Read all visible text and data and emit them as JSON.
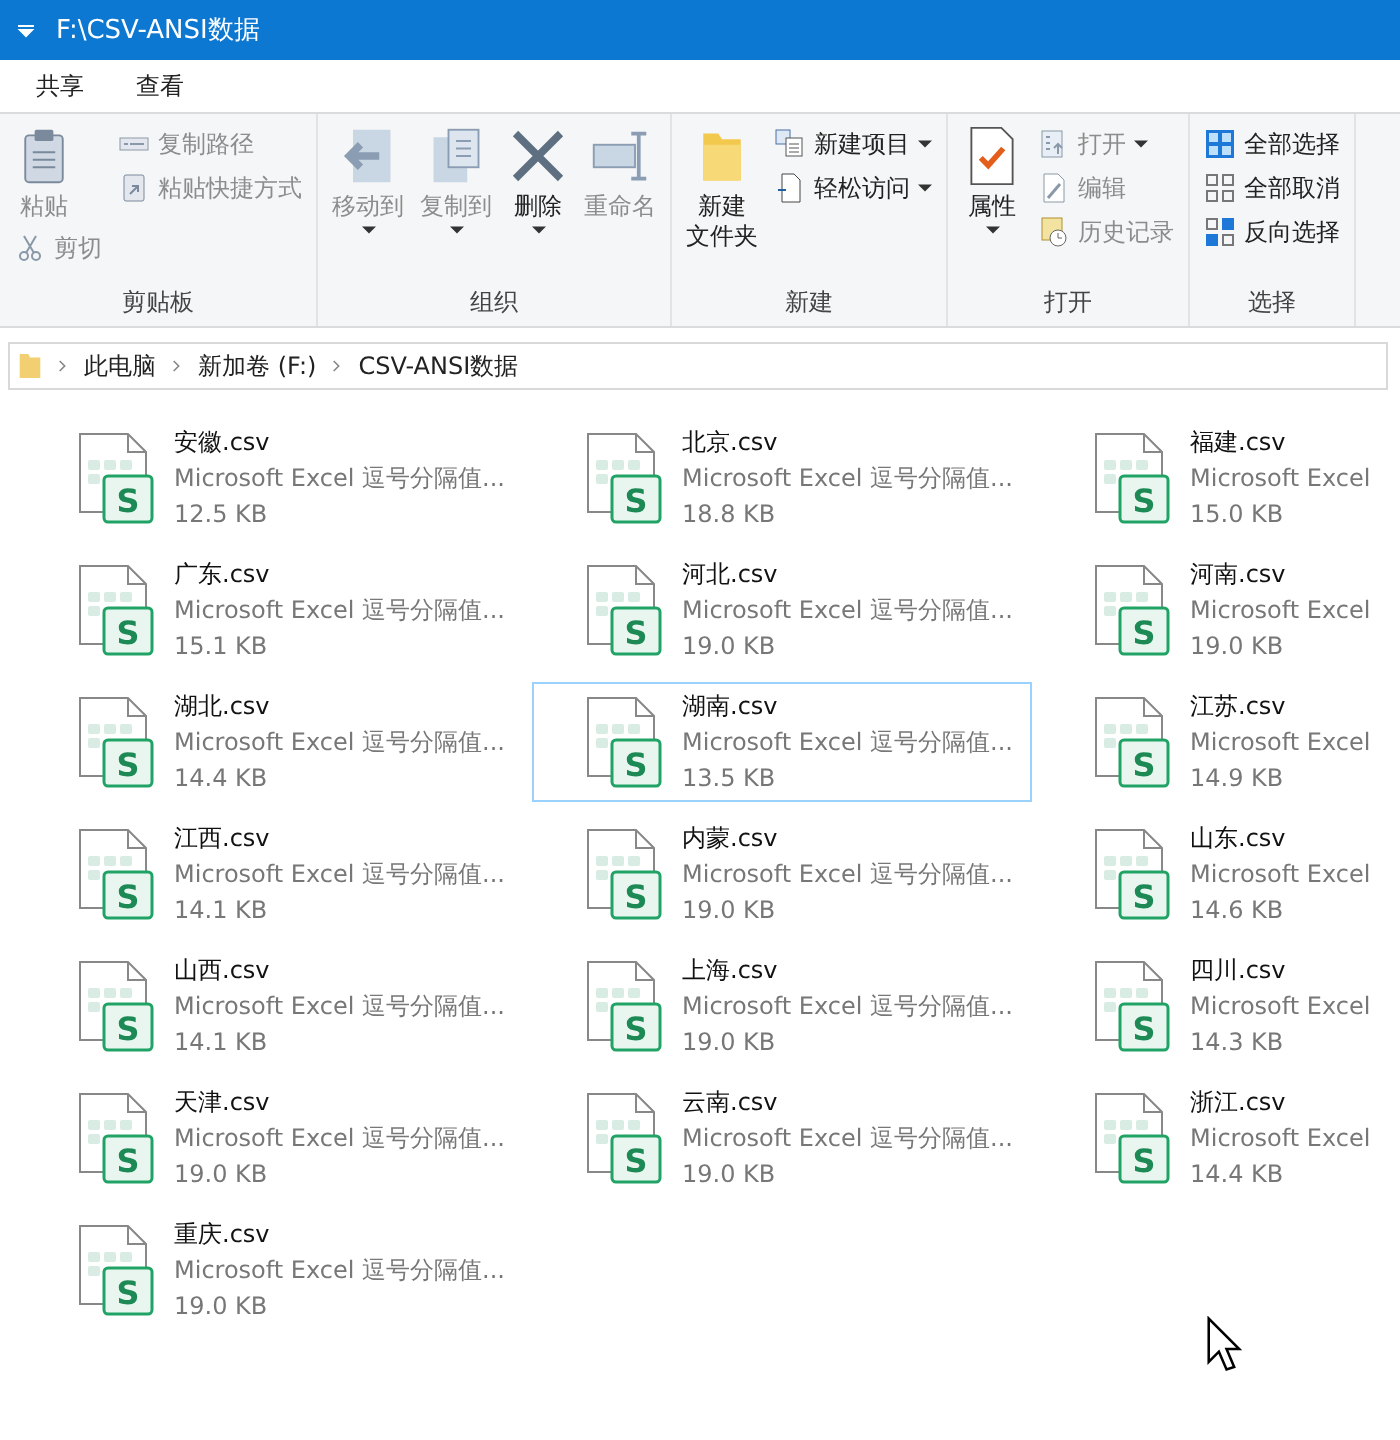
{
  "window": {
    "title": "F:\\CSV-ANSI数据"
  },
  "ribbon_tabs": [
    {
      "label": "共享",
      "selected": false
    },
    {
      "label": "查看",
      "selected": false
    }
  ],
  "ribbon": {
    "groups": [
      {
        "label": "剪贴板",
        "columns": [
          [
            {
              "kind": "large",
              "label": "粘贴",
              "disabled": true,
              "dropdown": false
            },
            {
              "kind": "small",
              "label": "剪切",
              "disabled": true,
              "dropdown": false
            }
          ],
          [
            {
              "kind": "small",
              "label": "复制路径",
              "disabled": true,
              "dropdown": false
            },
            {
              "kind": "small",
              "label": "粘贴快捷方式",
              "disabled": true,
              "dropdown": false
            }
          ]
        ]
      },
      {
        "label": "组织",
        "columns": [
          [
            {
              "kind": "large",
              "label": "移动到",
              "disabled": true,
              "dropdown": true
            }
          ],
          [
            {
              "kind": "large",
              "label": "复制到",
              "disabled": true,
              "dropdown": true
            }
          ],
          [
            {
              "kind": "large",
              "label": "删除",
              "disabled": false,
              "dropdown": true
            }
          ],
          [
            {
              "kind": "large",
              "label": "重命名",
              "disabled": true,
              "dropdown": false
            }
          ]
        ]
      },
      {
        "label": "新建",
        "columns": [
          [
            {
              "kind": "large",
              "label": "新建",
              "label_2": "文件夹",
              "disabled": false,
              "dropdown": false
            }
          ],
          [
            {
              "kind": "small",
              "label": "新建项目",
              "disabled": false,
              "dropdown": true
            },
            {
              "kind": "small",
              "label": "轻松访问",
              "disabled": false,
              "dropdown": true
            }
          ]
        ]
      },
      {
        "label": "打开",
        "columns": [
          [
            {
              "kind": "large",
              "label": "属性",
              "disabled": false,
              "dropdown": true
            }
          ],
          [
            {
              "kind": "small",
              "label": "打开",
              "disabled": true,
              "dropdown": true
            },
            {
              "kind": "small",
              "label": "编辑",
              "disabled": true,
              "dropdown": false
            },
            {
              "kind": "small",
              "label": "历史记录",
              "disabled": true,
              "dropdown": false
            }
          ]
        ]
      },
      {
        "label": "选择",
        "columns": [
          [
            {
              "kind": "small",
              "label": "全部选择",
              "disabled": false,
              "dropdown": false
            },
            {
              "kind": "small",
              "label": "全部取消",
              "disabled": false,
              "dropdown": false
            },
            {
              "kind": "small",
              "label": "反向选择",
              "disabled": false,
              "dropdown": false
            }
          ]
        ]
      }
    ]
  },
  "breadcrumb": [
    "此电脑",
    "新加卷 (F:)",
    "CSV-ANSI数据"
  ],
  "files": [
    {
      "name": "安徽.csv",
      "icon_letter": "S",
      "type": "Microsoft Excel 逗号分隔值...",
      "size": "12.5 KB",
      "selected": false
    },
    {
      "name": "北京.csv",
      "icon_letter": "S",
      "type": "Microsoft Excel 逗号分隔值...",
      "size": "18.8 KB",
      "selected": false
    },
    {
      "name": "福建.csv",
      "icon_letter": "S",
      "type": "Microsoft Excel",
      "size": "15.0 KB",
      "selected": false
    },
    {
      "name": "广东.csv",
      "icon_letter": "S",
      "type": "Microsoft Excel 逗号分隔值...",
      "size": "15.1 KB",
      "selected": false
    },
    {
      "name": "河北.csv",
      "icon_letter": "S",
      "type": "Microsoft Excel 逗号分隔值...",
      "size": "19.0 KB",
      "selected": false
    },
    {
      "name": "河南.csv",
      "icon_letter": "S",
      "type": "Microsoft Excel",
      "size": "19.0 KB",
      "selected": false
    },
    {
      "name": "湖北.csv",
      "icon_letter": "S",
      "type": "Microsoft Excel 逗号分隔值...",
      "size": "14.4 KB",
      "selected": false
    },
    {
      "name": "湖南.csv",
      "icon_letter": "S",
      "type": "Microsoft Excel 逗号分隔值...",
      "size": "13.5 KB",
      "selected": true
    },
    {
      "name": "江苏.csv",
      "icon_letter": "S",
      "type": "Microsoft Excel",
      "size": "14.9 KB",
      "selected": false
    },
    {
      "name": "江西.csv",
      "icon_letter": "S",
      "type": "Microsoft Excel 逗号分隔值...",
      "size": "14.1 KB",
      "selected": false
    },
    {
      "name": "内蒙.csv",
      "icon_letter": "S",
      "type": "Microsoft Excel 逗号分隔值...",
      "size": "19.0 KB",
      "selected": false
    },
    {
      "name": "山东.csv",
      "icon_letter": "S",
      "type": "Microsoft Excel",
      "size": "14.6 KB",
      "selected": false
    },
    {
      "name": "山西.csv",
      "icon_letter": "S",
      "type": "Microsoft Excel 逗号分隔值...",
      "size": "14.1 KB",
      "selected": false
    },
    {
      "name": "上海.csv",
      "icon_letter": "S",
      "type": "Microsoft Excel 逗号分隔值...",
      "size": "19.0 KB",
      "selected": false
    },
    {
      "name": "四川.csv",
      "icon_letter": "S",
      "type": "Microsoft Excel",
      "size": "14.3 KB",
      "selected": false
    },
    {
      "name": "天津.csv",
      "icon_letter": "S",
      "type": "Microsoft Excel 逗号分隔值...",
      "size": "19.0 KB",
      "selected": false
    },
    {
      "name": "云南.csv",
      "icon_letter": "S",
      "type": "Microsoft Excel 逗号分隔值...",
      "size": "19.0 KB",
      "selected": false
    },
    {
      "name": "浙江.csv",
      "icon_letter": "S",
      "type": "Microsoft Excel",
      "size": "14.4 KB",
      "selected": false
    },
    {
      "name": "重庆.csv",
      "icon_letter": "S",
      "type": "Microsoft Excel 逗号分隔值...",
      "size": "19.0 KB",
      "selected": false
    }
  ]
}
